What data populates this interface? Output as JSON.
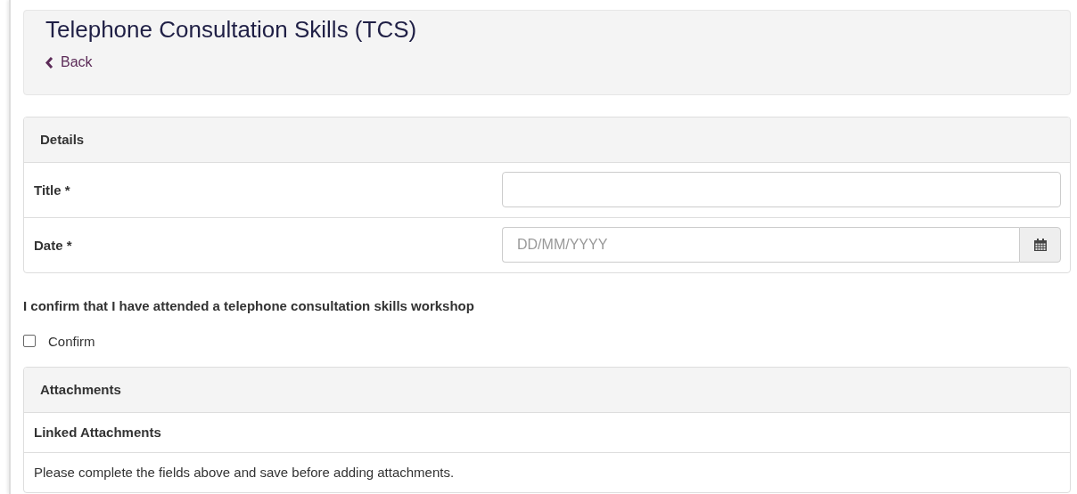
{
  "header": {
    "title": "Telephone Consultation Skills (TCS)",
    "back_link": "Back"
  },
  "details": {
    "heading": "Details",
    "fields": [
      {
        "kind": "text",
        "label": "Title *"
      },
      {
        "kind": "date",
        "label": "Date *",
        "placeholder": "DD/MM/YYYY"
      }
    ]
  },
  "confirmation": {
    "statement": "I confirm that I have attended a telephone consultation skills workshop",
    "checkbox_label": "Confirm",
    "checked": false
  },
  "attachments": {
    "heading": "Attachments",
    "subheading": "Linked Attachments",
    "message": "Please complete the fields above and save before adding attachments."
  }
}
